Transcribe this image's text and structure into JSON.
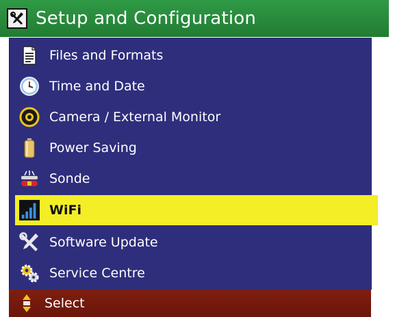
{
  "window": {
    "title": "Setup and Configuration",
    "title_icon": "tools-icon"
  },
  "menu": {
    "items": [
      {
        "label": "Files and Formats",
        "icon": "document-icon"
      },
      {
        "label": "Time and Date",
        "icon": "clock-icon"
      },
      {
        "label": "Camera / External Monitor",
        "icon": "camera-monitor-icon"
      },
      {
        "label": "Power Saving",
        "icon": "battery-icon"
      },
      {
        "label": "Sonde",
        "icon": "sonde-icon"
      },
      {
        "label": "WiFi",
        "icon": "wifi-signal-icon"
      },
      {
        "label": "Software Update",
        "icon": "wrench-screwdriver-icon"
      },
      {
        "label": "Service Centre",
        "icon": "gears-icon"
      }
    ],
    "selected_label": "WiFi"
  },
  "status": {
    "label": "Select",
    "icon": "up-down-arrows-icon"
  },
  "colors": {
    "title_bar": "#217c33",
    "menu_background": "#2f2e7c",
    "selection": "#f3ee26",
    "status_bar": "#7e1e10"
  }
}
